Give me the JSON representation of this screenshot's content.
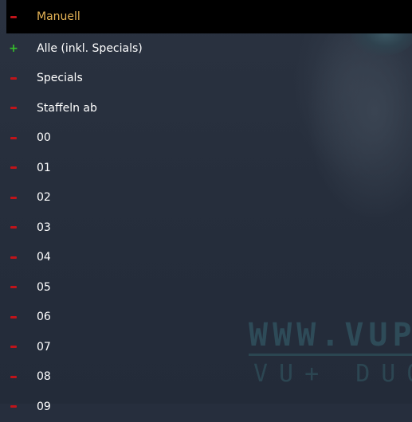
{
  "items": [
    {
      "label": "Manuell",
      "icon": "minus-icon",
      "selected": true
    },
    {
      "label": "Alle (inkl. Specials)",
      "icon": "plus-icon"
    },
    {
      "label": "Specials",
      "icon": "minus-icon"
    },
    {
      "label": "Staffeln ab",
      "icon": "minus-icon"
    },
    {
      "label": "00",
      "icon": "minus-icon"
    },
    {
      "label": "01",
      "icon": "minus-icon"
    },
    {
      "label": "02",
      "icon": "minus-icon"
    },
    {
      "label": "03",
      "icon": "minus-icon"
    },
    {
      "label": "04",
      "icon": "minus-icon"
    },
    {
      "label": "05",
      "icon": "minus-icon"
    },
    {
      "label": "06",
      "icon": "minus-icon"
    },
    {
      "label": "07",
      "icon": "minus-icon"
    },
    {
      "label": "08",
      "icon": "minus-icon"
    },
    {
      "label": "09",
      "icon": "minus-icon"
    }
  ],
  "background": {
    "watermark_url": "WWW.VUP",
    "watermark_brand": "VU+ DUO"
  },
  "colors": {
    "selected_text": "#e6b456",
    "minus": "#c0141a",
    "plus": "#35c02b"
  }
}
